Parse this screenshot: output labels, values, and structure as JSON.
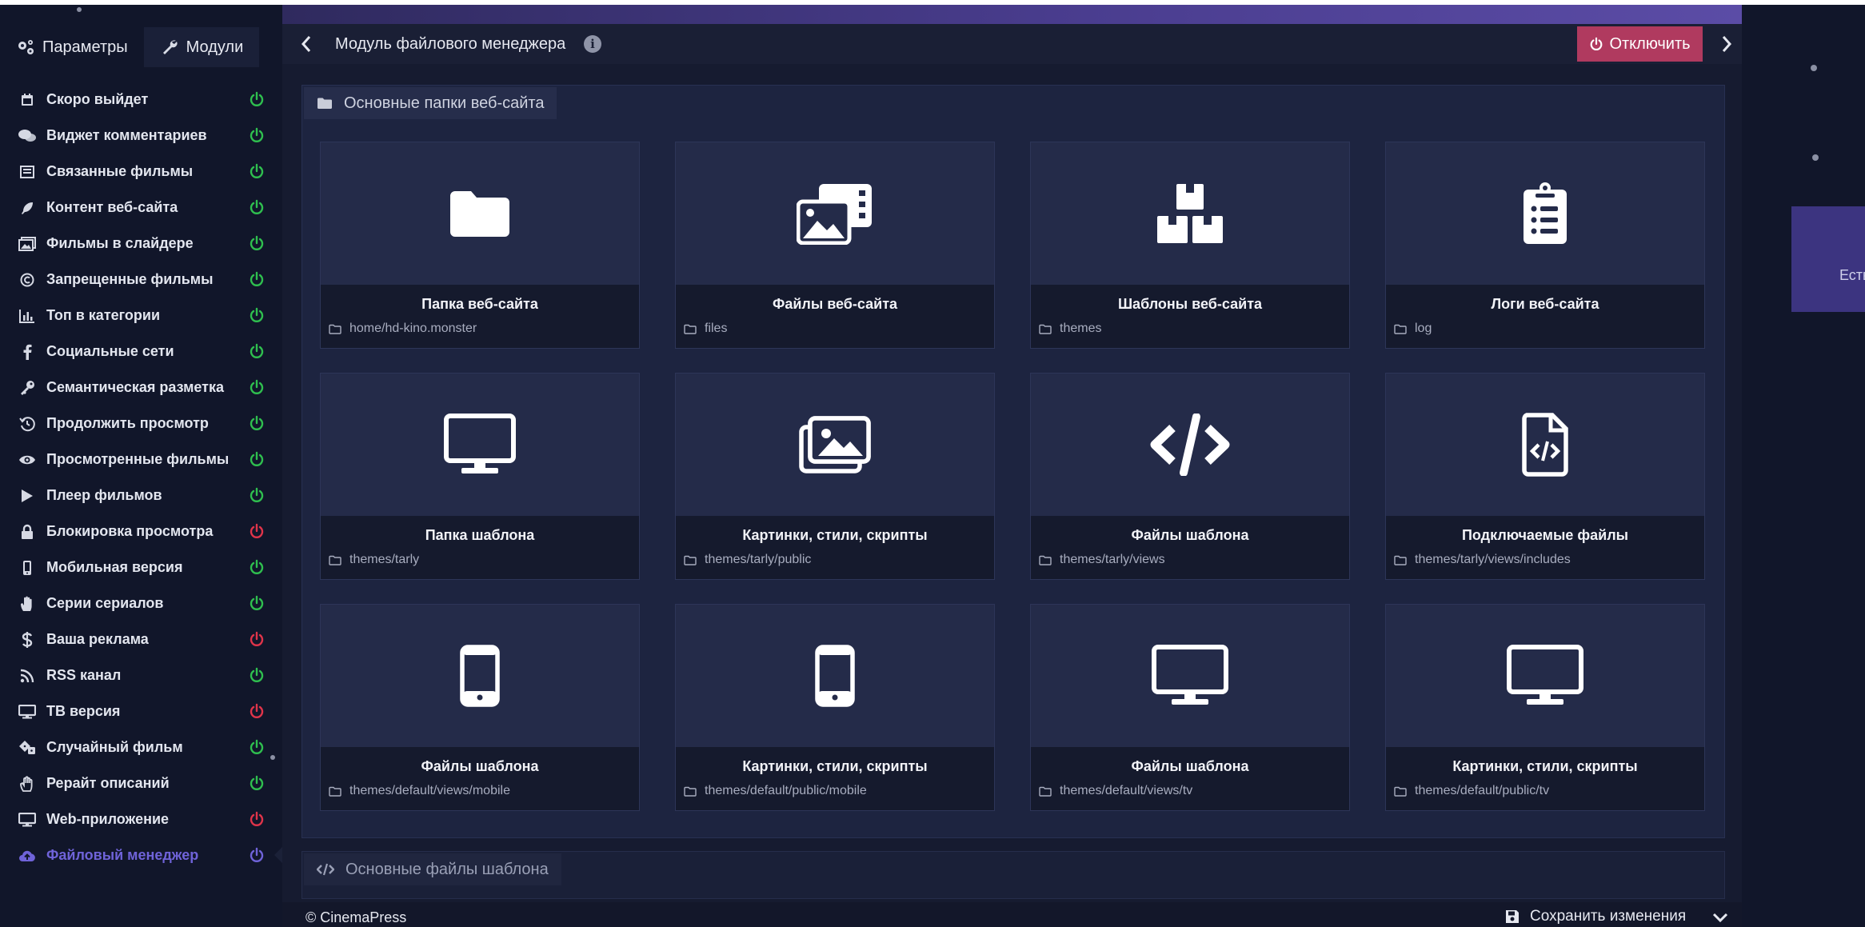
{
  "sidebar": {
    "tabs": [
      {
        "label": "Параметры",
        "icon": "gears-icon"
      },
      {
        "label": "Модули",
        "icon": "wrench-icon"
      }
    ],
    "items": [
      {
        "label": "Скоро выйдет",
        "icon": "calendar-icon",
        "status": "on"
      },
      {
        "label": "Виджет комментариев",
        "icon": "comments-icon",
        "status": "on"
      },
      {
        "label": "Связанные фильмы",
        "icon": "list-icon",
        "status": "on"
      },
      {
        "label": "Контент веб-сайта",
        "icon": "feather-icon",
        "status": "on"
      },
      {
        "label": "Фильмы в слайдере",
        "icon": "images-icon",
        "status": "on"
      },
      {
        "label": "Запрещенные фильмы",
        "icon": "copyright-icon",
        "status": "on"
      },
      {
        "label": "Топ в категории",
        "icon": "bar-chart-icon",
        "status": "on"
      },
      {
        "label": "Социальные сети",
        "icon": "facebook-icon",
        "status": "on"
      },
      {
        "label": "Семантическая разметка",
        "icon": "key-icon",
        "status": "on"
      },
      {
        "label": "Продолжить просмотр",
        "icon": "history-icon",
        "status": "on"
      },
      {
        "label": "Просмотренные фильмы",
        "icon": "eye-icon",
        "status": "on"
      },
      {
        "label": "Плеер фильмов",
        "icon": "play-icon",
        "status": "on"
      },
      {
        "label": "Блокировка просмотра",
        "icon": "lock-icon",
        "status": "off"
      },
      {
        "label": "Мобильная версия",
        "icon": "mobile-icon",
        "status": "on"
      },
      {
        "label": "Серии сериалов",
        "icon": "hand-icon",
        "status": "on"
      },
      {
        "label": "Ваша реклама",
        "icon": "dollar-icon",
        "status": "off"
      },
      {
        "label": "RSS канал",
        "icon": "rss-icon",
        "status": "on"
      },
      {
        "label": "ТВ версия",
        "icon": "desktop-icon",
        "status": "off"
      },
      {
        "label": "Случайный фильм",
        "icon": "dice-icon",
        "status": "on"
      },
      {
        "label": "Рерайт описаний",
        "icon": "hand-paper-icon",
        "status": "on"
      },
      {
        "label": "Web-приложение",
        "icon": "desktop-icon",
        "status": "off"
      },
      {
        "label": "Файловый менеджер",
        "icon": "cloud-upload-icon",
        "status": "active"
      }
    ]
  },
  "header": {
    "title": "Модуль файлового менеджера",
    "disable_label": "Отключить"
  },
  "panel": {
    "title": "Основные папки веб-сайта",
    "cards": [
      {
        "title": "Папка веб-сайта",
        "path": "home/hd-kino.monster",
        "icon": "folder-icon"
      },
      {
        "title": "Файлы веб-сайта",
        "path": "files",
        "icon": "photo-video-icon"
      },
      {
        "title": "Шаблоны веб-сайта",
        "path": "themes",
        "icon": "boxes-icon"
      },
      {
        "title": "Логи веб-сайта",
        "path": "log",
        "icon": "clipboard-list-icon"
      },
      {
        "title": "Папка шаблона",
        "path": "themes/tarly",
        "icon": "desktop-icon"
      },
      {
        "title": "Картинки, стили, скрипты",
        "path": "themes/tarly/public",
        "icon": "images-icon"
      },
      {
        "title": "Файлы шаблона",
        "path": "themes/tarly/views",
        "icon": "code-icon"
      },
      {
        "title": "Подключаемые файлы",
        "path": "themes/tarly/views/includes",
        "icon": "file-code-icon"
      },
      {
        "title": "Файлы шаблона",
        "path": "themes/default/views/mobile",
        "icon": "mobile-icon"
      },
      {
        "title": "Картинки, стили, скрипты",
        "path": "themes/default/public/mobile",
        "icon": "mobile-icon"
      },
      {
        "title": "Файлы шаблона",
        "path": "themes/default/views/tv",
        "icon": "desktop-icon"
      },
      {
        "title": "Картинки, стили, скрипты",
        "path": "themes/default/public/tv",
        "icon": "desktop-icon"
      }
    ]
  },
  "panel2": {
    "title": "Основные файлы шаблона"
  },
  "footer": {
    "copyright": "© CinemaPress",
    "save_label": "Сохранить изменения"
  },
  "promo": {
    "text": "Есть"
  },
  "colors": {
    "on": "#2fbf4f",
    "off": "#e0344a",
    "active": "#6f63d9",
    "disable_button": "#b03a5f"
  }
}
